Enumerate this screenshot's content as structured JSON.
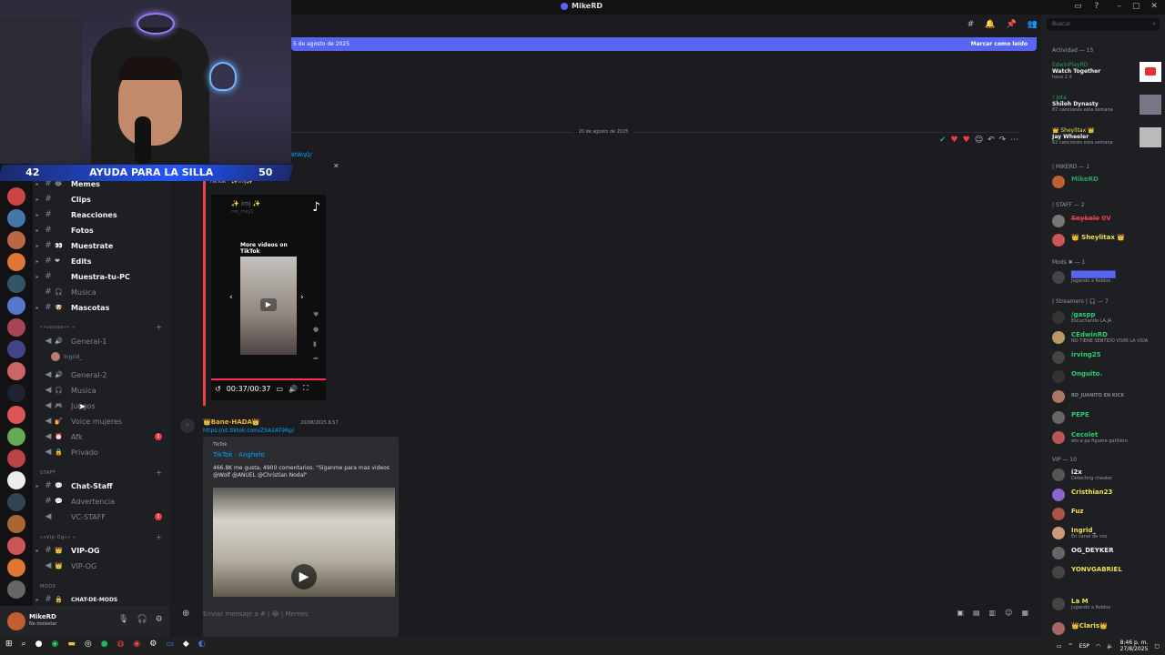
{
  "window": {
    "title": "MikeRD"
  },
  "goal": {
    "current": "42",
    "label": "AYUDA PARA LA SILLA",
    "target": "50"
  },
  "channels": [
    {
      "name": "Memes",
      "emoji": "😂",
      "type": "text",
      "top": 0
    },
    {
      "name": "Clips",
      "emoji": "",
      "type": "text"
    },
    {
      "name": "Reacciones",
      "emoji": "",
      "type": "text"
    },
    {
      "name": "Fotos",
      "emoji": "",
      "type": "text"
    },
    {
      "name": "Muestrate",
      "emoji": "👀",
      "type": "text"
    },
    {
      "name": "Edits",
      "emoji": "❤",
      "type": "text"
    },
    {
      "name": "Muestra-tu-PC",
      "emoji": "",
      "type": "text"
    },
    {
      "name": "Musica",
      "emoji": "🎧",
      "type": "text",
      "muted": true
    },
    {
      "name": "Mascotas",
      "emoji": "🐶",
      "type": "text"
    }
  ],
  "voice_category": "««voices»» «",
  "voice_channels": [
    {
      "name": "General-1",
      "emoji": "🔊"
    },
    {
      "name": "General-2",
      "emoji": "🔊"
    },
    {
      "name": "Musica",
      "emoji": "🎧"
    },
    {
      "name": "Juegos",
      "emoji": "🎮"
    },
    {
      "name": "Voice mujeres",
      "emoji": "💅"
    },
    {
      "name": "Afk",
      "emoji": "⏰",
      "alert": "1"
    },
    {
      "name": "Privado",
      "emoji": "🔒"
    }
  ],
  "voice_user": "Ingrid_",
  "staff_category": "STAFF",
  "staff_channels": [
    {
      "name": "Chat-Staff",
      "type": "text"
    },
    {
      "name": "Advertencia",
      "type": "text"
    },
    {
      "name": "VC-STAFF",
      "type": "voice",
      "alert": "1"
    }
  ],
  "vip_category": "««Vip-Og»» «",
  "vip_channels": [
    {
      "name": "VIP-OG",
      "type": "text"
    },
    {
      "name": "VIP-OG",
      "type": "voice"
    }
  ],
  "mods_category": "MODS",
  "mods_channels": [
    {
      "name": "CHAT-DE-MODS",
      "type": "text"
    }
  ],
  "user": {
    "name": "MikeRD",
    "status": "No molestar"
  },
  "new_banner": {
    "date": "5 de agosto de 2025",
    "mark_read": "Marcar como leído"
  },
  "date_separator": "20 de agosto de 2025",
  "link_fragment": "8tWqQ/",
  "embed1": {
    "title": "TikTok · ✨imj✨",
    "handle": "✨ imj ✨",
    "sub": "mo_may1",
    "more": "More videos on TikTok",
    "time": "00:37/00:37"
  },
  "message2": {
    "author": "👑Bane-HADA👑",
    "timestamp": "20/08/2025 8:57",
    "url": "https://vt.tiktok.com/ZSA2AT9Rp/",
    "provider": "TikTok",
    "embed_title": "TikTok · Anghelo",
    "embed_desc": "466.8K me gusta, 4900 comentarios. \"Síganme para mas videos @Wolf @ANUEL @Christian Nodal\""
  },
  "composer": {
    "placeholder": "Enviar mensaje a # | 😂 | Memes"
  },
  "search": {
    "placeholder": "Buscar"
  },
  "activity": {
    "header": "Actividad — 15",
    "items": [
      {
        "user": "EdwinPlayRD",
        "title": "Watch Together",
        "sub": "hace 2 d",
        "thumb": "#d33"
      },
      {
        "user": "! Jota",
        "title": "Shiloh Dynasty",
        "sub": "87 canciones esta semana",
        "thumb": "#778"
      },
      {
        "user": "👑 Sheylitax 👑",
        "title": "Jay Wheeler",
        "sub": "62 canciones esta semana",
        "thumb": "#999"
      }
    ]
  },
  "member_groups": [
    {
      "header": "| MIKERD — 1",
      "members": [
        {
          "name": "MikeRD",
          "status": "",
          "color": "#23a559",
          "av": "#c06030"
        }
      ]
    },
    {
      "header": "| STAFF — 2",
      "members": [
        {
          "name": "S̶e̶y̶k̶e̶l̶o̶ 0V",
          "status": "",
          "color": "#ed4245",
          "av": "#777"
        },
        {
          "name": "👑 Sheylitax 👑",
          "status": "",
          "color": "#f0e04a",
          "av": "#c55"
        }
      ]
    },
    {
      "header": "Mods ✖ — 1",
      "members": [
        {
          "name": "█████████",
          "status": "Jugando a Roblox",
          "color": "#5865f2",
          "av": "#444"
        }
      ]
    },
    {
      "header": "| Streamers | 🎧 — 7",
      "members": [
        {
          "name": "/gaspp",
          "status": "Escuchando LA.JA",
          "color": "#2ecc71",
          "av": "#333"
        },
        {
          "name": "CEdwinRD",
          "status": "NO TIENE SENTIDO VIVIR LA VIDA",
          "color": "#2ecc71",
          "av": "#b96"
        },
        {
          "name": "irving25",
          "status": "",
          "color": "#2ecc71",
          "av": "#444"
        },
        {
          "name": "Onguito.",
          "status": "",
          "color": "#2ecc71",
          "av": "#333"
        },
        {
          "name": "RD_JUANITO EN KICK",
          "status": "",
          "color": "#80848e",
          "av": "#a76"
        },
        {
          "name": "PEPE",
          "status": "",
          "color": "#2ecc71",
          "av": "#666"
        },
        {
          "name": "Cecolet",
          "status": "eto a pa figuere gatillero",
          "color": "#2ecc71",
          "av": "#b55"
        }
      ]
    },
    {
      "header": "VIP — 10",
      "members": [
        {
          "name": "i2x",
          "status": "Detecting cheater",
          "color": "#f2f3f5",
          "av": "#555"
        },
        {
          "name": "Cristhian23",
          "status": "",
          "color": "#f0e04a",
          "av": "#86c"
        },
        {
          "name": "Fuz",
          "status": "",
          "color": "#f0e04a",
          "av": "#a54"
        },
        {
          "name": "Ingrid_",
          "status": "En canal de voz",
          "color": "#f0e04a",
          "av": "#c97"
        },
        {
          "name": "OG_DEYKER",
          "status": "",
          "color": "#f2f3f5",
          "av": "#666"
        },
        {
          "name": "YONVGABRIEL",
          "status": "",
          "color": "#f0e04a",
          "av": "#444"
        },
        {
          "name": "La M",
          "status": "Jugando a Roblox",
          "color": "#f0e04a",
          "av": "#444"
        },
        {
          "name": "👑Claris👑",
          "status": "",
          "color": "#f0e04a",
          "av": "#a66"
        }
      ]
    }
  ],
  "taskbar": {
    "time": "8:46 p. m.",
    "date": "27/8/2025",
    "lang": "ESP"
  },
  "colors": {
    "accent": "#5865f2",
    "danger": "#ed4245",
    "online": "#23a559"
  }
}
